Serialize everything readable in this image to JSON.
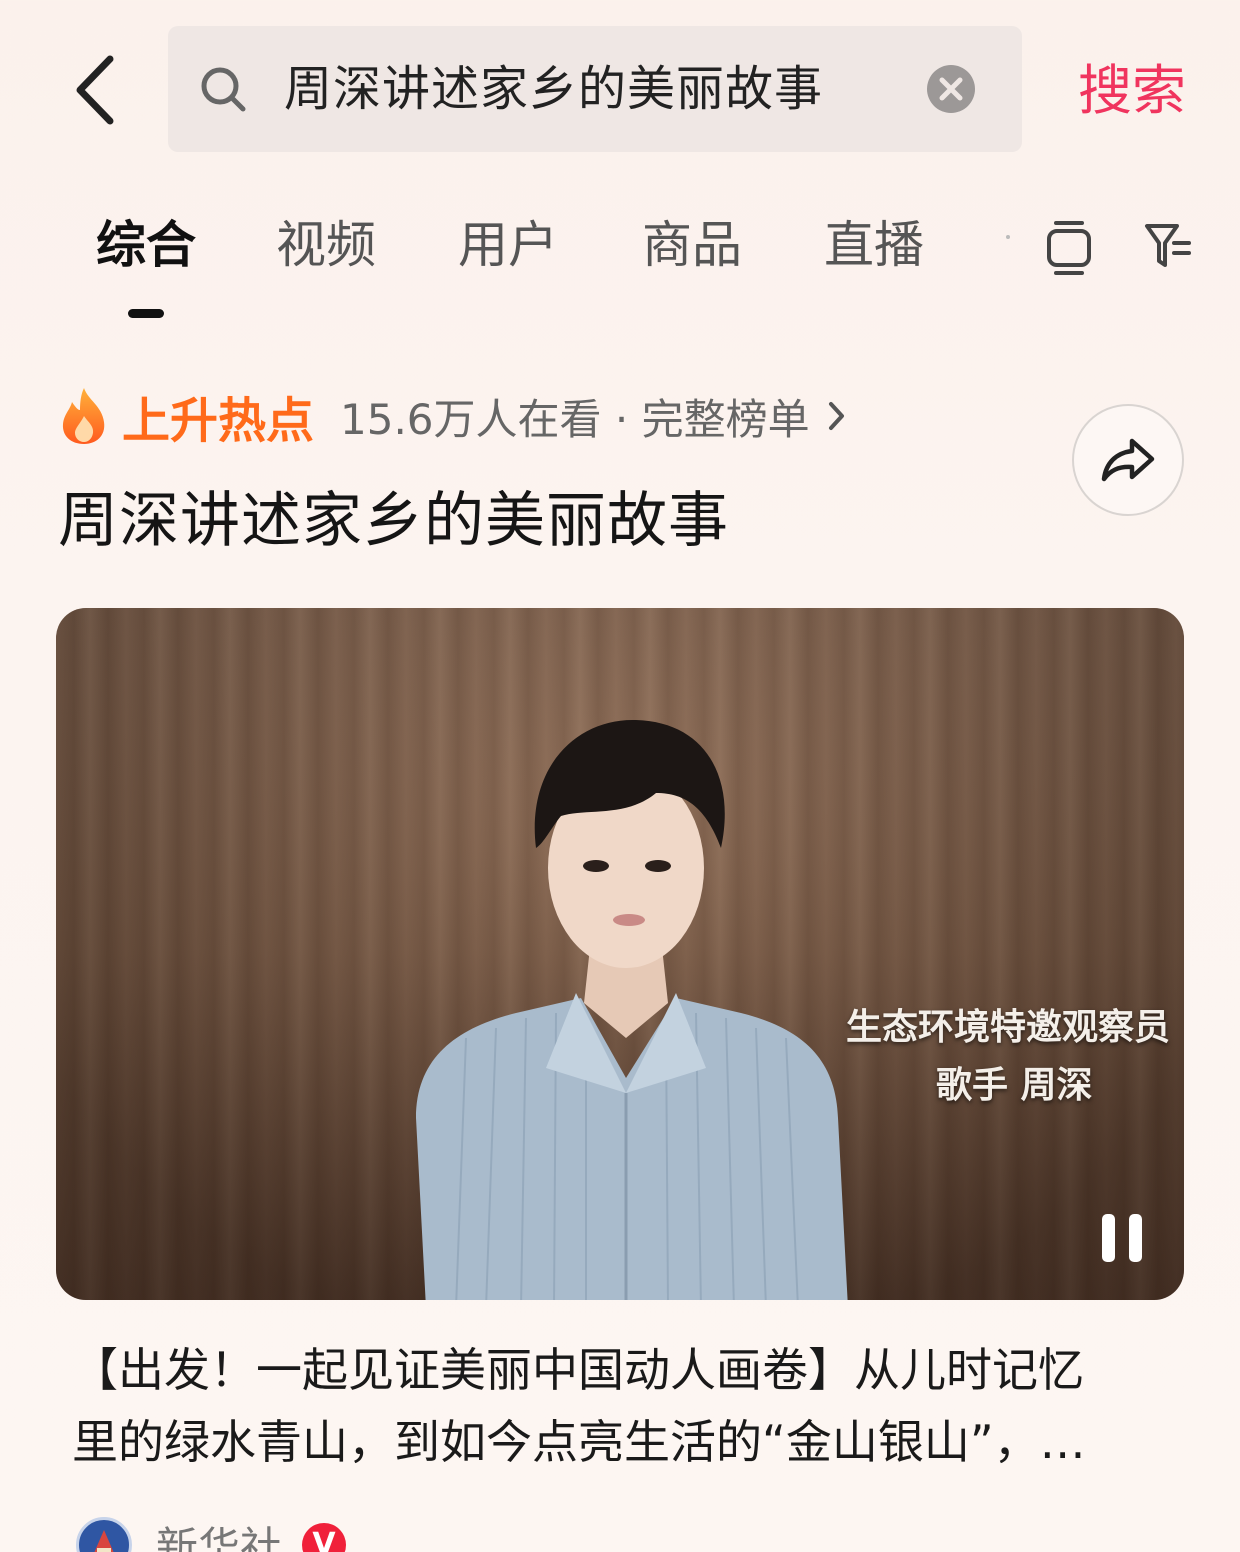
{
  "header": {
    "search_value": "周深讲述家乡的美丽故事",
    "search_button": "搜索"
  },
  "tabs": [
    {
      "label": "综合",
      "active": true
    },
    {
      "label": "视频"
    },
    {
      "label": "用户"
    },
    {
      "label": "商品"
    },
    {
      "label": "直播"
    }
  ],
  "hot": {
    "tag": "上升热点",
    "meta": "15.6万人在看 · 完整榜单",
    "title": "周深讲述家乡的美丽故事"
  },
  "video": {
    "caption_line1": "生态环境特邀观察员",
    "caption_line2": "歌手 周深"
  },
  "post": {
    "desc_line1": "【出发！一起见证美丽中国动人画卷】从儿时记忆",
    "desc_line2": "里的绿水青山，到如今点亮生活的“金山银山”，…",
    "author": "新华社",
    "badge": "V"
  },
  "colors": {
    "accent": "#f0345e",
    "hot": "#ff6a1a"
  }
}
